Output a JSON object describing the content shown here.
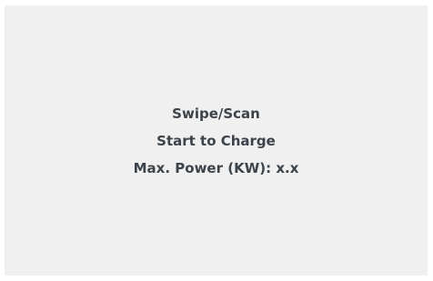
{
  "screen": {
    "background": "#eff0ef",
    "text_color": "#3d434a",
    "lines": [
      "Swipe/Scan",
      "Start to Charge",
      "Max. Power (KW): x.x"
    ]
  }
}
